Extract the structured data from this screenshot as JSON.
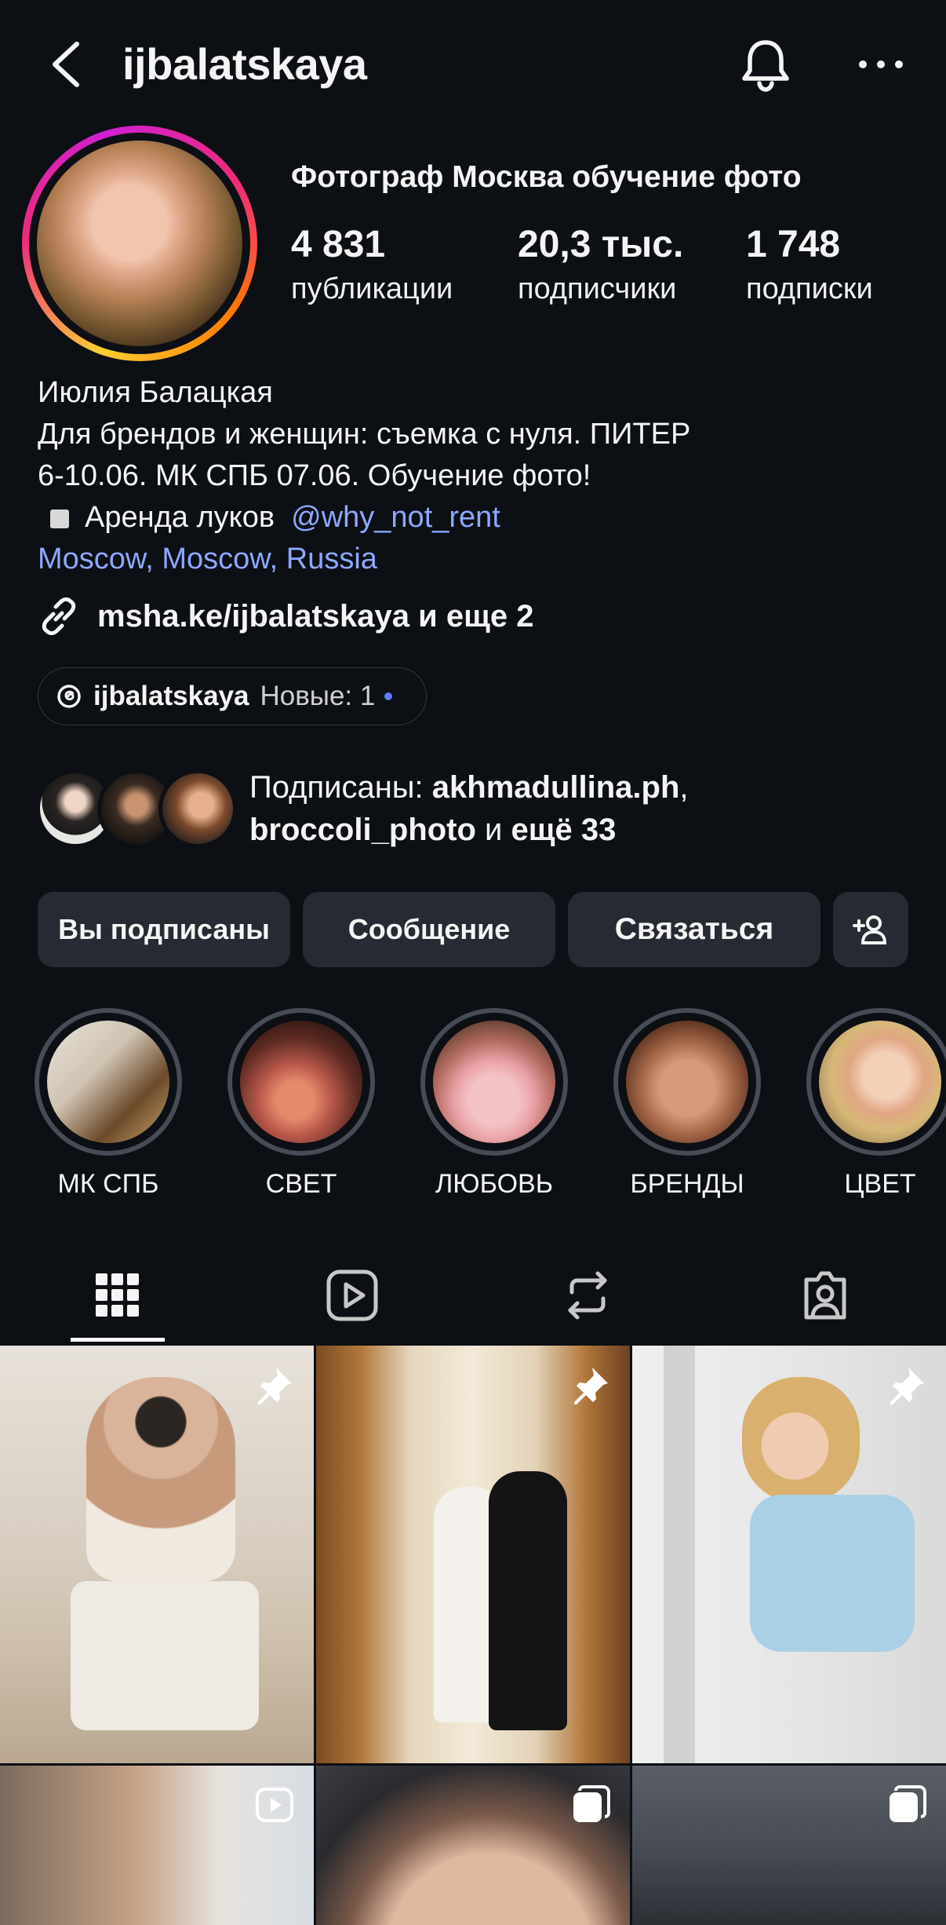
{
  "header": {
    "username": "ijbalatskaya"
  },
  "profile": {
    "category": "Фотограф Москва обучение фото",
    "stats": [
      {
        "value": "4 831",
        "label": "публикации"
      },
      {
        "value": "20,3 тыс.",
        "label": "подписчики"
      },
      {
        "value": "1 748",
        "label": "подписки"
      }
    ],
    "bio": {
      "name": "Июлия Балацкая",
      "line1": "Для брендов и женщин: съемка с нуля. ПИТЕР",
      "line2": "6-10.06. МК СПБ 07.06. Обучение фото!",
      "rent_text": "Аренда луков",
      "rent_mention": "@why_not_rent",
      "location": "Moscow, Moscow, Russia"
    },
    "link": "msha.ke/ijbalatskaya и еще 2",
    "threads": {
      "name": "ijbalatskaya",
      "new_label": "Новые: 1"
    },
    "followed_by": {
      "prefix": "Подписаны: ",
      "user1": "akhmadullina.ph",
      "sep": ",",
      "user2": "broccoli_photo",
      "mid": " и ",
      "rest": "ещё 33"
    }
  },
  "actions": {
    "following": "Вы подписаны",
    "message": "Сообщение",
    "contact": "Связаться"
  },
  "highlights": [
    {
      "label": "МК СПБ"
    },
    {
      "label": "СВЕТ"
    },
    {
      "label": "ЛЮБОВЬ"
    },
    {
      "label": "БРЕНДЫ"
    },
    {
      "label": "ЦВЕТ"
    }
  ],
  "tabs": [
    "grid-icon",
    "reels-icon",
    "reposts-icon",
    "tagged-icon"
  ],
  "colors": {
    "background": "#0c0f14",
    "button": "#262a33",
    "link": "#8ea8ff"
  }
}
